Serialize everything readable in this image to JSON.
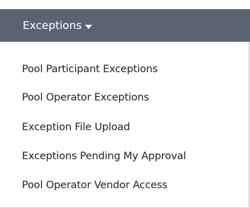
{
  "menu": {
    "title": "Exceptions",
    "caret_icon": "caret-down-icon",
    "header_color": "#5a6470",
    "items": [
      {
        "label": "Pool Participant Exceptions"
      },
      {
        "label": "Pool Operator Exceptions"
      },
      {
        "label": "Exception File Upload"
      },
      {
        "label": "Exceptions Pending My Approval"
      },
      {
        "label": "Pool Operator Vendor Access"
      }
    ]
  }
}
